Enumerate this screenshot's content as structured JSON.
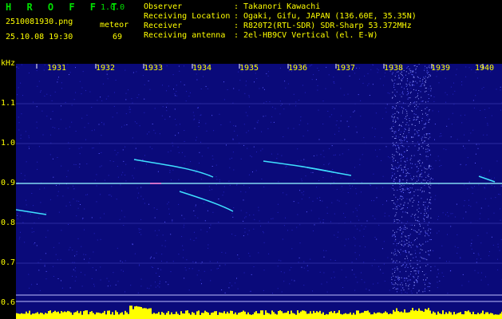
{
  "header": {
    "app_name": "H R O F F T",
    "version": "1.0.0",
    "filename": "2510081930.png",
    "datetime": "25.10.08 19:30",
    "meteor_label": "meteor",
    "meteor_count": "69",
    "info": [
      {
        "label": "Observer",
        "value": "Takanori Kawachi"
      },
      {
        "label": "Receiving Location",
        "value": "Ogaki, Gifu, JAPAN (136.60E, 35.35N)"
      },
      {
        "label": "Receiver",
        "value": "R820T2(RTL-SDR) SDR-Sharp 53.372MHz"
      },
      {
        "label": "Receiving antenna",
        "value": "2el-HB9CV Vertical (el. E-W)"
      }
    ],
    "colon": ":"
  },
  "axes": {
    "y_unit": "kHz",
    "y_ticks": [
      "1.1",
      "1.0",
      "0.9",
      "0.8",
      "0.7",
      "0.6"
    ],
    "x_ticks": [
      "1931",
      "1932",
      "1933",
      "1934",
      "1935",
      "1936",
      "1937",
      "1938",
      "1939",
      "1940"
    ]
  },
  "colors": {
    "background": "#000000",
    "noise": "#0a0a8a",
    "text": "#ffff00",
    "app_name": "#00e000",
    "echo": "#3fe0ff",
    "carrier": "#8ff0ff",
    "power_trace": "#ffff00"
  }
}
